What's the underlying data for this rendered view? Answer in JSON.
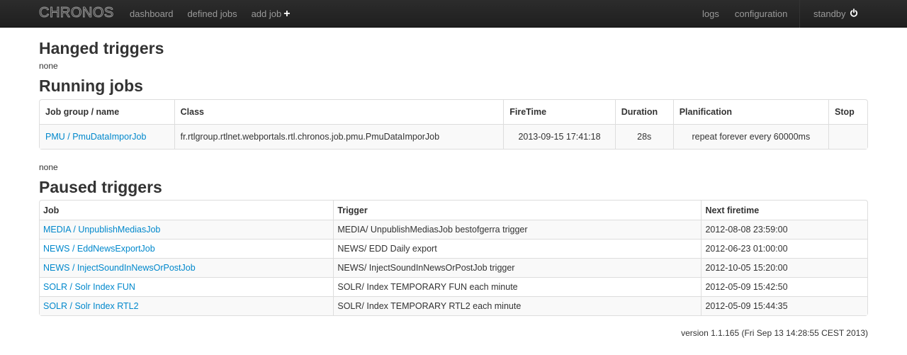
{
  "nav": {
    "brand": "CHRONOS",
    "dashboard": "dashboard",
    "defined_jobs": "defined jobs",
    "add_job": "add job",
    "logs": "logs",
    "configuration": "configuration",
    "standby": "standby"
  },
  "hanged": {
    "title": "Hanged triggers",
    "value": "none"
  },
  "running": {
    "title": "Running jobs",
    "headers": [
      "Job group / name",
      "Class",
      "FireTime",
      "Duration",
      "Planification",
      "Stop"
    ],
    "rows": [
      {
        "job": "PMU / PmuDataImporJob",
        "class": "fr.rtlgroup.rtlnet.webportals.rtl.chronos.job.pmu.PmuDataImporJob",
        "firetime": "2013-09-15 17:41:18",
        "duration": "28s",
        "planification": "repeat forever every 60000ms",
        "stop": ""
      }
    ],
    "after": "none"
  },
  "paused": {
    "title": "Paused triggers",
    "headers": [
      "Job",
      "Trigger",
      "Next firetime"
    ],
    "rows": [
      {
        "job": "MEDIA / UnpublishMediasJob",
        "trigger": "MEDIA/ UnpublishMediasJob bestofgerra trigger",
        "next": "2012-08-08 23:59:00"
      },
      {
        "job": "NEWS / EddNewsExportJob",
        "trigger": "NEWS/ EDD Daily export",
        "next": "2012-06-23 01:00:00"
      },
      {
        "job": "NEWS / InjectSoundInNewsOrPostJob",
        "trigger": "NEWS/ InjectSoundInNewsOrPostJob trigger",
        "next": "2012-10-05 15:20:00"
      },
      {
        "job": "SOLR / Solr Index FUN",
        "trigger": "SOLR/ Index TEMPORARY FUN each minute",
        "next": "2012-05-09 15:42:50"
      },
      {
        "job": "SOLR / Solr Index RTL2",
        "trigger": "SOLR/ Index TEMPORARY RTL2 each minute",
        "next": "2012-05-09 15:44:35"
      }
    ]
  },
  "footer": {
    "version": "version 1.1.165 (Fri Sep 13 14:28:55 CEST 2013)"
  },
  "icons": {
    "add": "plus-icon",
    "standby": "power-icon"
  },
  "colors": {
    "link": "#0088cc",
    "navbar": "#222222"
  }
}
